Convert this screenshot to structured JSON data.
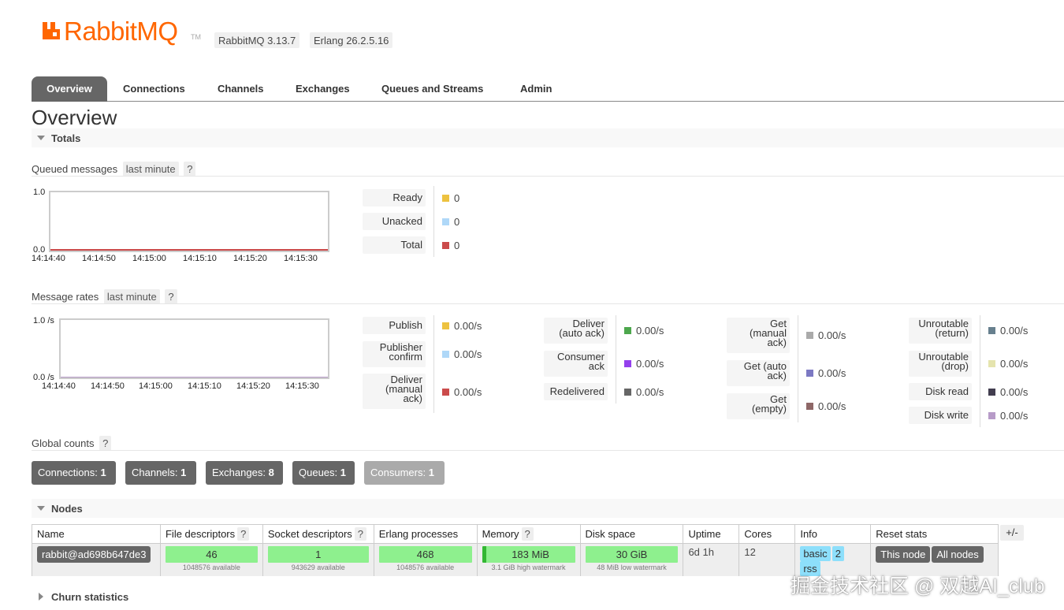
{
  "header": {
    "brand": "RabbitMQ",
    "trademark": "TM",
    "rabbitmq_version": "RabbitMQ 3.13.7",
    "erlang_version": "Erlang 26.2.5.16",
    "brand_color": "#ff6600"
  },
  "tabs": [
    {
      "label": "Overview",
      "active": true
    },
    {
      "label": "Connections"
    },
    {
      "label": "Channels"
    },
    {
      "label": "Exchanges"
    },
    {
      "label": "Queues and Streams"
    },
    {
      "label": "Admin"
    }
  ],
  "page_title": "Overview",
  "totals": {
    "section_label": "Totals",
    "queued": {
      "heading": "Queued messages",
      "range": "last minute",
      "help": "?",
      "y_top": "1.0",
      "y_bottom": "0.0",
      "x_ticks": [
        "14:14:40",
        "14:14:50",
        "14:15:00",
        "14:15:10",
        "14:15:20",
        "14:15:30"
      ],
      "legend": [
        {
          "label": "Ready",
          "value": "0",
          "color": "#edc240"
        },
        {
          "label": "Unacked",
          "value": "0",
          "color": "#afd8f8"
        },
        {
          "label": "Total",
          "value": "0",
          "color": "#cb4b4b"
        }
      ]
    },
    "rates": {
      "heading": "Message rates",
      "range": "last minute",
      "help": "?",
      "y_top": "1.0 /s",
      "y_bottom": "0.0 /s",
      "x_ticks": [
        "14:14:40",
        "14:14:50",
        "14:15:00",
        "14:15:10",
        "14:15:20",
        "14:15:30"
      ],
      "col1": [
        {
          "label": "Publish",
          "value": "0.00/s",
          "color": "#edc240"
        },
        {
          "label": "Publisher confirm",
          "value": "0.00/s",
          "color": "#afd8f8"
        },
        {
          "label": "Deliver (manual ack)",
          "value": "0.00/s",
          "color": "#cb4b4b"
        }
      ],
      "col2": [
        {
          "label": "Deliver (auto ack)",
          "value": "0.00/s",
          "color": "#4da74d"
        },
        {
          "label": "Consumer ack",
          "value": "0.00/s",
          "color": "#9440ed"
        },
        {
          "label": "Redelivered",
          "value": "0.00/s",
          "color": "#666666"
        }
      ],
      "col3": [
        {
          "label": "Get (manual ack)",
          "value": "0.00/s",
          "color": "#aaaaaa"
        },
        {
          "label": "Get (auto ack)",
          "value": "0.00/s",
          "color": "#7c79c3"
        },
        {
          "label": "Get (empty)",
          "value": "0.00/s",
          "color": "#8e6767"
        }
      ],
      "col4": [
        {
          "label": "Unroutable (return)",
          "value": "0.00/s",
          "color": "#67808e"
        },
        {
          "label": "Unroutable (drop)",
          "value": "0.00/s",
          "color": "#e5e4ae"
        },
        {
          "label": "Disk read",
          "value": "0.00/s",
          "color": "#423d4f"
        },
        {
          "label": "Disk write",
          "value": "0.00/s",
          "color": "#b79bc8"
        }
      ]
    }
  },
  "global_counts": {
    "heading": "Global counts",
    "help": "?",
    "items": [
      {
        "label": "Connections:",
        "value": "1"
      },
      {
        "label": "Channels:",
        "value": "1"
      },
      {
        "label": "Exchanges:",
        "value": "8"
      },
      {
        "label": "Queues:",
        "value": "1"
      },
      {
        "label": "Consumers:",
        "value": "1"
      }
    ]
  },
  "nodes": {
    "section_label": "Nodes",
    "columns": {
      "name": "Name",
      "fd": "File descriptors",
      "sd": "Socket descriptors",
      "erl": "Erlang processes",
      "mem": "Memory",
      "disk": "Disk space",
      "uptime": "Uptime",
      "cores": "Cores",
      "info": "Info",
      "reset": "Reset stats"
    },
    "help": "?",
    "plus_minus": "+/-",
    "row": {
      "name": "rabbit@ad698b647de3",
      "fd": "46",
      "fd_sub": "1048576 available",
      "sd": "1",
      "sd_sub": "943629 available",
      "erl": "468",
      "erl_sub": "1048576 available",
      "mem": "183 MiB",
      "mem_sub": "3.1 GiB high watermark",
      "disk": "30 GiB",
      "disk_sub": "48 MiB low watermark",
      "uptime": "6d 1h",
      "cores": "12",
      "info_tags": [
        "basic",
        "2",
        "rss"
      ],
      "reset_this": "This node",
      "reset_all": "All nodes"
    }
  },
  "churn": {
    "section_label": "Churn statistics"
  },
  "watermark": "掘金技术社区 @ 双越AI_club"
}
